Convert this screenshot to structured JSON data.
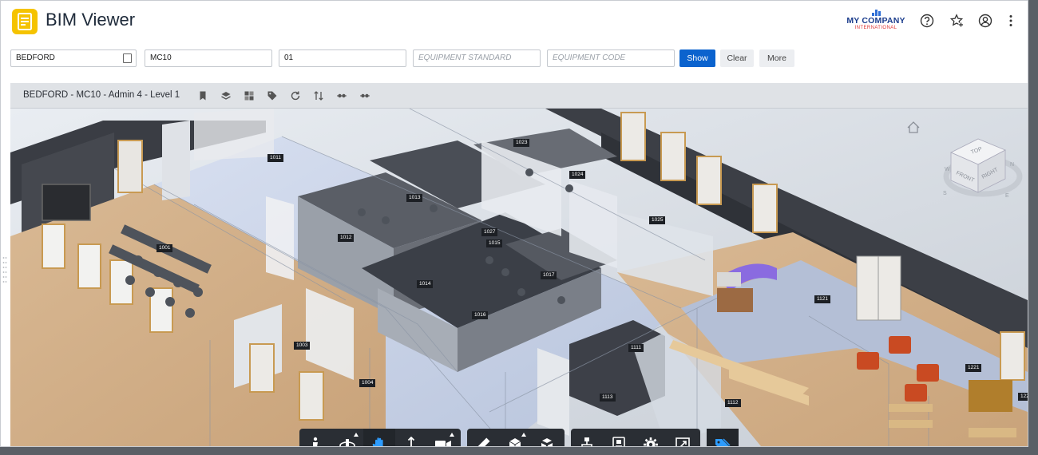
{
  "header": {
    "title": "BIM Viewer",
    "company": {
      "name": "MY COMPANY",
      "subtitle": "INTERNATIONAL"
    },
    "icons": [
      "help-icon",
      "favorites-icon",
      "user-icon",
      "more-vertical-icon"
    ]
  },
  "filters": {
    "site": {
      "value": "BEDFORD"
    },
    "building": {
      "value": "MC10"
    },
    "level": {
      "value": "01"
    },
    "equipment_standard": {
      "placeholder": "EQUIPMENT STANDARD"
    },
    "equipment_code": {
      "placeholder": "EQUIPMENT CODE"
    },
    "show_label": "Show",
    "clear_label": "Clear",
    "more_label": "More"
  },
  "viewer": {
    "title": "BEDFORD - MC10 - Admin 4 - Level 1",
    "toolbar_icons": [
      "bookmark-icon",
      "layers-icon",
      "grid-icon",
      "tag-icon",
      "refresh-icon",
      "sort-icon",
      "nav-left-icon",
      "nav-right-icon"
    ],
    "viewcube": {
      "top": "TOP",
      "front": "FRONT",
      "right": "RIGHT",
      "compass_n": "N",
      "compass_s": "S",
      "compass_e": "E",
      "compass_w": "W"
    }
  },
  "room_tags": [
    "1011",
    "1023",
    "1024",
    "1013",
    "1025",
    "1012",
    "1027",
    "1015",
    "1001",
    "1017",
    "1014",
    "1121",
    "1016",
    "1003",
    "1111",
    "1004",
    "1221",
    "1113",
    "1112",
    "122"
  ],
  "bottom_toolbar": {
    "groups": [
      [
        "walk-icon",
        "orbit-icon",
        "pan-icon",
        "zoom-icon",
        "camera-icon"
      ],
      [
        "measure-icon",
        "section-icon",
        "explode-icon"
      ],
      [
        "model-browser-icon",
        "properties-icon",
        "settings-icon",
        "fullscreen-icon"
      ],
      [
        "tags-icon"
      ]
    ]
  },
  "colors": {
    "accent": "#0b63ce",
    "brand": "#f5c300"
  }
}
